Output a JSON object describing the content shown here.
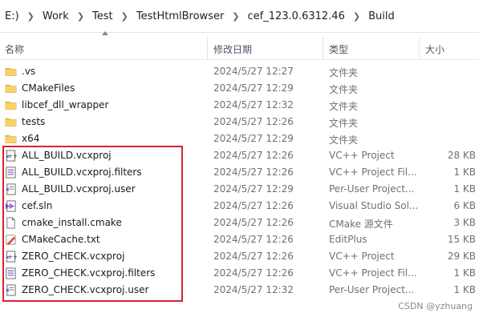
{
  "breadcrumb": {
    "items": [
      "E:)",
      "Work",
      "Test",
      "TestHtmlBrowser",
      "cef_123.0.6312.46",
      "Build"
    ]
  },
  "columns": {
    "name": "名称",
    "date": "修改日期",
    "type": "类型",
    "size": "大小"
  },
  "rows": [
    {
      "name": ".vs",
      "date": "2024/5/27 12:27",
      "type": "文件夹",
      "size": "",
      "icon": "folder-icon"
    },
    {
      "name": "CMakeFiles",
      "date": "2024/5/27 12:29",
      "type": "文件夹",
      "size": "",
      "icon": "folder-icon"
    },
    {
      "name": "libcef_dll_wrapper",
      "date": "2024/5/27 12:32",
      "type": "文件夹",
      "size": "",
      "icon": "folder-icon"
    },
    {
      "name": "tests",
      "date": "2024/5/27 12:26",
      "type": "文件夹",
      "size": "",
      "icon": "folder-icon"
    },
    {
      "name": "x64",
      "date": "2024/5/27 12:29",
      "type": "文件夹",
      "size": "",
      "icon": "folder-icon"
    },
    {
      "name": "ALL_BUILD.vcxproj",
      "date": "2024/5/27 12:26",
      "type": "VC++ Project",
      "size": "28 KB",
      "icon": "vcxproj-icon"
    },
    {
      "name": "ALL_BUILD.vcxproj.filters",
      "date": "2024/5/27 12:26",
      "type": "VC++ Project Fil...",
      "size": "1 KB",
      "icon": "filters-icon"
    },
    {
      "name": "ALL_BUILD.vcxproj.user",
      "date": "2024/5/27 12:29",
      "type": "Per-User Project...",
      "size": "1 KB",
      "icon": "user-project-icon"
    },
    {
      "name": "cef.sln",
      "date": "2024/5/27 12:26",
      "type": "Visual Studio Sol...",
      "size": "6 KB",
      "icon": "sln-icon"
    },
    {
      "name": "cmake_install.cmake",
      "date": "2024/5/27 12:26",
      "type": "CMake 源文件",
      "size": "3 KB",
      "icon": "file-icon"
    },
    {
      "name": "CMakeCache.txt",
      "date": "2024/5/27 12:26",
      "type": "EditPlus",
      "size": "15 KB",
      "icon": "editplus-icon"
    },
    {
      "name": "ZERO_CHECK.vcxproj",
      "date": "2024/5/27 12:26",
      "type": "VC++ Project",
      "size": "29 KB",
      "icon": "vcxproj-icon"
    },
    {
      "name": "ZERO_CHECK.vcxproj.filters",
      "date": "2024/5/27 12:26",
      "type": "VC++ Project Fil...",
      "size": "1 KB",
      "icon": "filters-icon"
    },
    {
      "name": "ZERO_CHECK.vcxproj.user",
      "date": "2024/5/27 12:32",
      "type": "Per-User Project...",
      "size": "1 KB",
      "icon": "user-project-icon"
    }
  ],
  "watermark": "CSDN @yzhuang",
  "colors": {
    "highlight_box": "#d9232e",
    "folder": "#f4c64e",
    "vs_purple": "#7b4fbf"
  }
}
